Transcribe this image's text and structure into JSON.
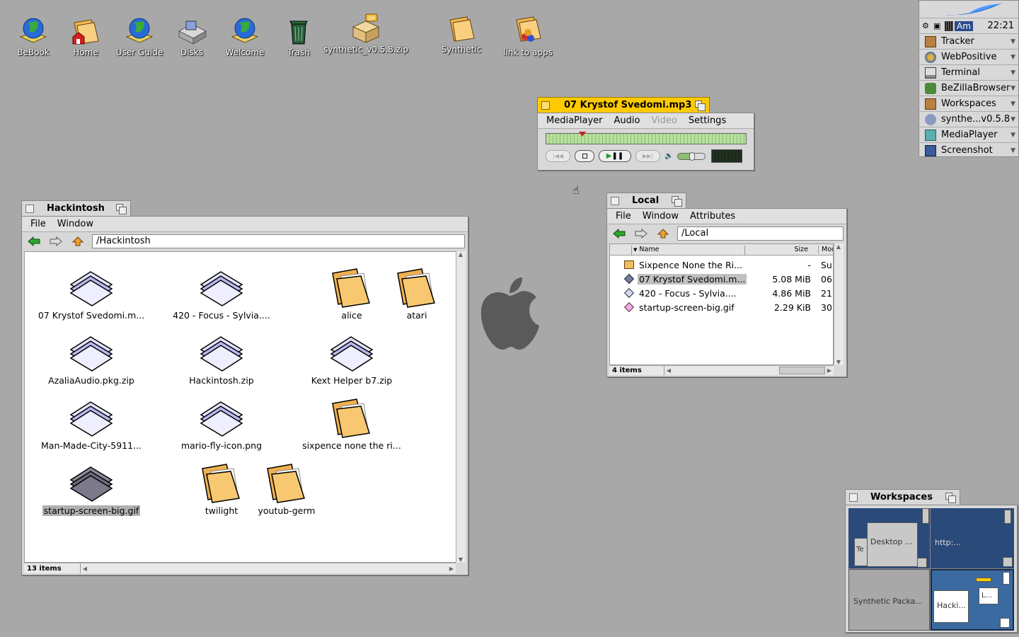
{
  "desktop": {
    "icons": [
      {
        "label": "BeBook",
        "icon": "globe-book-icon"
      },
      {
        "label": "Home",
        "icon": "home-folder-icon"
      },
      {
        "label": "User Guide",
        "icon": "globe-book-icon"
      },
      {
        "label": "Disks",
        "icon": "disks-icon"
      },
      {
        "label": "Welcome",
        "icon": "globe-book-icon"
      },
      {
        "label": "Trash",
        "icon": "trash-icon"
      },
      {
        "label": "synthetic_v0.5.8.zip",
        "icon": "zip-package-icon"
      },
      {
        "label": "Synthetic",
        "icon": "folder-icon"
      },
      {
        "label": "link to apps",
        "icon": "apps-folder-icon"
      }
    ]
  },
  "deskbar": {
    "time": "22:21",
    "input": "Am",
    "items": [
      {
        "label": "Tracker",
        "color": "#8a5a2a"
      },
      {
        "label": "WebPositive",
        "color": "#3a6ab0"
      },
      {
        "label": "Terminal",
        "color": "#333333"
      },
      {
        "label": "BeZillaBrowser",
        "color": "#4a8a3a"
      },
      {
        "label": "Workspaces",
        "color": "#8a5a2a"
      },
      {
        "label": "synthe...v0.5.8",
        "color": "#6a7aa0"
      },
      {
        "label": "MediaPlayer",
        "color": "#4a8a8a"
      },
      {
        "label": "Screenshot",
        "color": "#3a5a9a"
      }
    ]
  },
  "media": {
    "title": "07 Krystof Svedomi.mp3",
    "menus": [
      "MediaPlayer",
      "Audio",
      "Video",
      "Settings"
    ],
    "progress": 0.18
  },
  "hackintosh": {
    "title": "Hackintosh",
    "menus": [
      "File",
      "Window"
    ],
    "path": "/Hackintosh",
    "files": [
      {
        "name": "07 Krystof Svedomi.m...",
        "type": "doc"
      },
      {
        "name": "420 - Focus - Sylvia....",
        "type": "doc"
      },
      {
        "name": "alice",
        "type": "folder"
      },
      {
        "name": "atari",
        "type": "folder"
      },
      {
        "name": "AzaliaAudio.pkg.zip",
        "type": "doc"
      },
      {
        "name": "Hackintosh.zip",
        "type": "doc"
      },
      {
        "name": "Kext Helper b7.zip",
        "type": "doc"
      },
      {
        "name": "Man-Made-City-5911...",
        "type": "doc"
      },
      {
        "name": "mario-fly-icon.png",
        "type": "doc"
      },
      {
        "name": "sixpence none the ri...",
        "type": "folder"
      },
      {
        "name": "startup-screen-big.gif",
        "type": "doc-selected"
      },
      {
        "name": "twilight",
        "type": "folder"
      },
      {
        "name": "youtub-germ",
        "type": "folder"
      }
    ],
    "count": "13 items"
  },
  "local": {
    "title": "Local",
    "menus": [
      "File",
      "Window",
      "Attributes"
    ],
    "path": "/Local",
    "columns": [
      "Name",
      "Size",
      "Mod"
    ],
    "rows": [
      {
        "name": "Sixpence None the Ri...",
        "size": "-",
        "mod": "Sur"
      },
      {
        "name": "07 Krystof Svedomi.m...",
        "size": "5.08 MiB",
        "mod": "06"
      },
      {
        "name": "420 - Focus - Sylvia....",
        "size": "4.86 MiB",
        "mod": "21"
      },
      {
        "name": "startup-screen-big.gif",
        "size": "2.29 KiB",
        "mod": "30"
      }
    ],
    "count": "4 items"
  },
  "workspaces": {
    "title": "Workspaces",
    "labels": [
      "Te",
      "Desktop ...",
      "http:...",
      "Synthetic Packa...",
      "Hacki...",
      "L..."
    ]
  }
}
